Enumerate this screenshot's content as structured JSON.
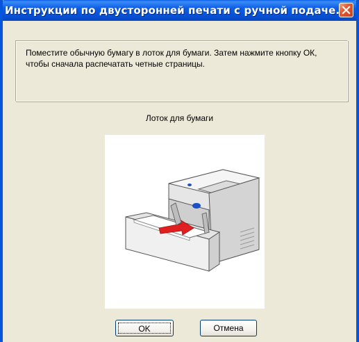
{
  "window": {
    "title": "Инструкции по двусторонней печати с ручной подаче...",
    "close_icon": "close-icon"
  },
  "message": {
    "text": "Поместите обычную бумагу в лоток для бумаги. Затем нажмите кнопку ОК, чтобы сначала распечатать четные страницы."
  },
  "illustration": {
    "label": "Лоток для бумаги",
    "image": "printer-paper-tray-illustration"
  },
  "buttons": {
    "ok_label": "OK",
    "cancel_label": "Отмена"
  },
  "colors": {
    "titlebar": "#0855dd",
    "window_bg": "#ece9d8",
    "close_button": "#e25a32",
    "arrow": "#e02020",
    "printer_accent": "#1a50c8"
  }
}
